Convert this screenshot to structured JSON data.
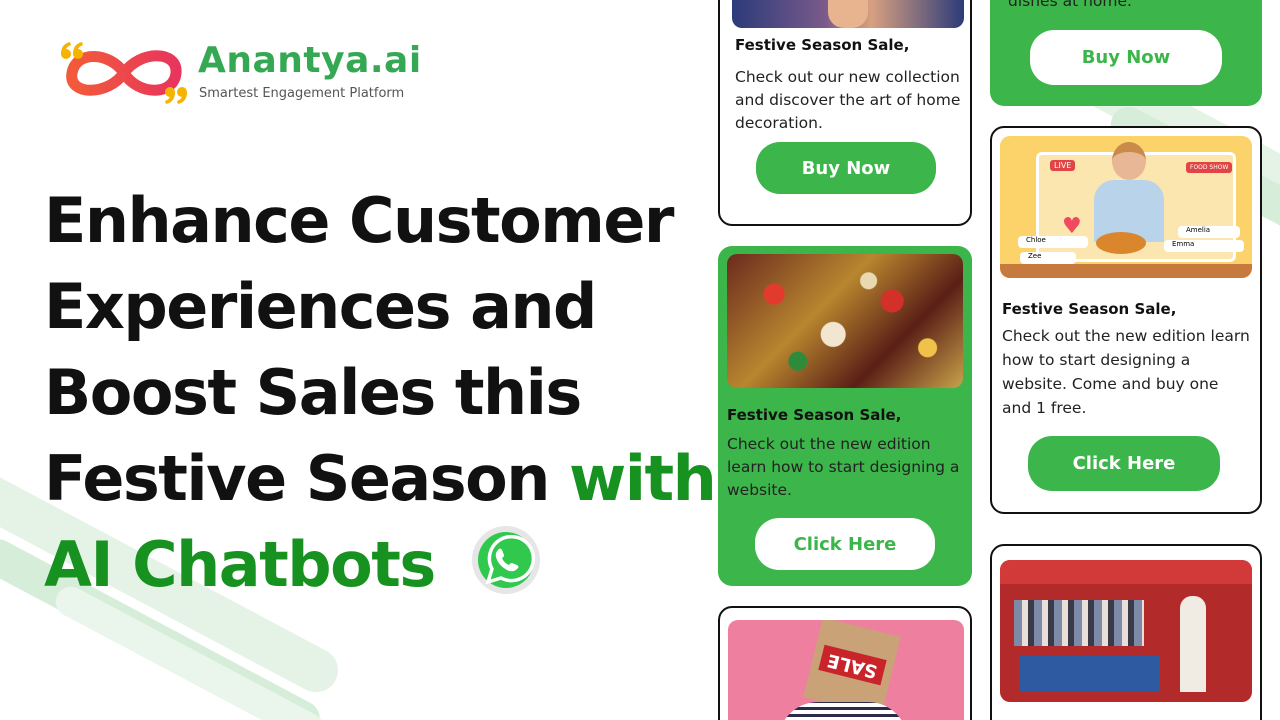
{
  "brand": {
    "name": "Anantya.ai",
    "tagline": "Smartest Engagement Platform"
  },
  "headline": {
    "line1": "Enhance Customer",
    "line2": "Experiences and",
    "line3": "Boost Sales this",
    "line4_plain": "Festive Season ",
    "line4_accent": "with",
    "line5_accent": "AI Chatbots"
  },
  "colors": {
    "brand_green": "#34a853",
    "accent_green": "#17911f",
    "card_green": "#3cb54a",
    "text_dark": "#111111"
  },
  "cards": {
    "top_right": {
      "body_fragment": "dishes at home.\"",
      "button": "Buy Now"
    },
    "home_decor": {
      "title": "Festive Season Sale,",
      "body": "Check out our new collection and discover the art of home decoration.",
      "button": "Buy Now"
    },
    "live_food": {
      "title": "Festive Season Sale,",
      "body": "Check out the new edition learn how to start designing a website. Come and buy one and 1 free.",
      "button": "Click Here",
      "badge_live": "LIVE",
      "badge_show": "FOOD SHOW",
      "chat_names": [
        "Chloe",
        "Amelia",
        "Zee",
        "Emma"
      ]
    },
    "ornaments": {
      "title": "Festive Season Sale,",
      "body": "Check out the new edition learn how to start designing a website.",
      "button": "Click Here"
    },
    "sale_bag": {
      "bag_text": "SALE"
    },
    "market": {}
  },
  "icons": [
    "infinity-logo-icon",
    "quote-icon",
    "whatsapp-icon"
  ]
}
